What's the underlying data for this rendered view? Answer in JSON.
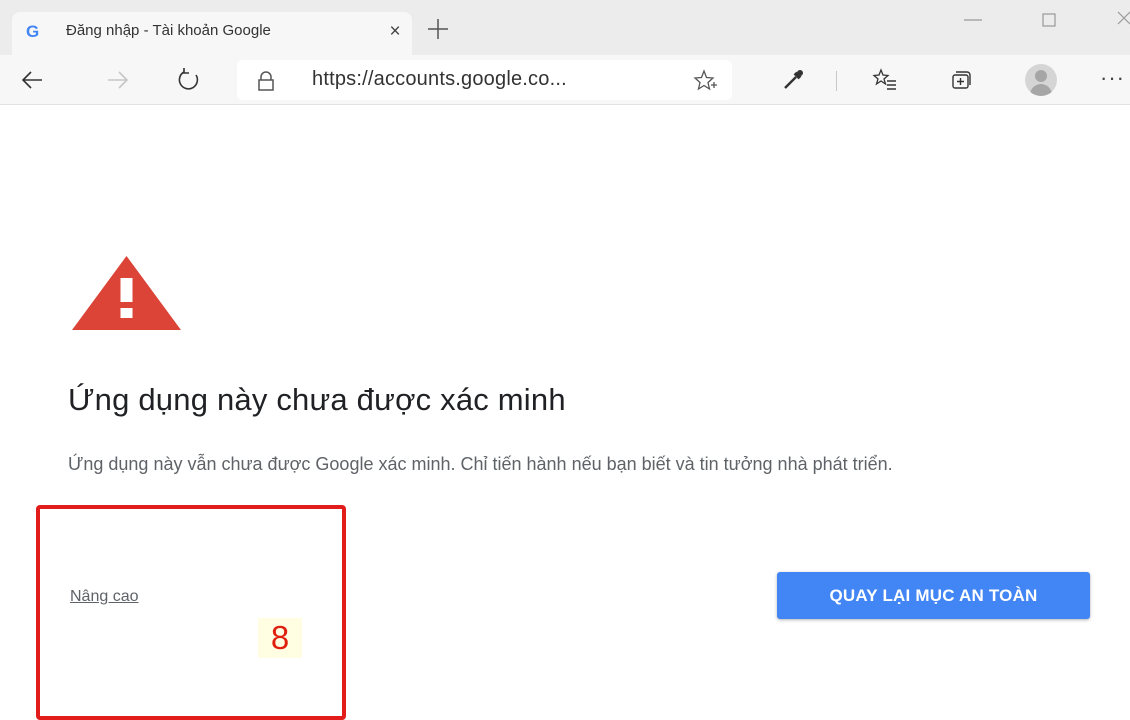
{
  "browser": {
    "tab": {
      "favicon": "G",
      "title": "Đăng nhập - Tài khoản Google",
      "close_glyph": "×"
    },
    "address_bar": {
      "url": "https://accounts.google.co..."
    },
    "toolbar": {
      "more_glyph": "···"
    }
  },
  "page": {
    "heading": "Ứng dụng này chưa được xác minh",
    "description": "Ứng dụng này vẫn chưa được Google xác minh. Chỉ tiến hành nếu bạn biết và tin tưởng nhà phát triển.",
    "advanced_link": "Nâng cao",
    "back_button": "QUAY LẠI MỤC AN TOÀN",
    "warning_color": "#db4437",
    "button_color": "#4285f4"
  },
  "annotation": {
    "step_number": "8",
    "box_color": "#e21b1b"
  }
}
